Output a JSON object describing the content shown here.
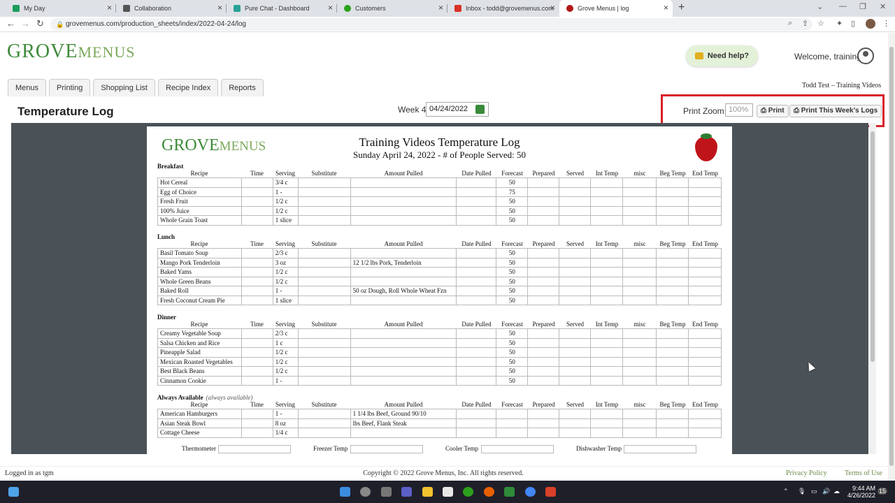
{
  "browser": {
    "tabs": [
      {
        "title": "My Day",
        "color": "#1a9c5b"
      },
      {
        "title": "Collaboration",
        "color": "#555555"
      },
      {
        "title": "Pure Chat - Dashboard",
        "color": "#2aa198"
      },
      {
        "title": "Customers",
        "color": "#2ca01c"
      },
      {
        "title": "Inbox - todd@grovemenus.com",
        "color": "#d93025"
      },
      {
        "title": "Grove Menus | log",
        "color": "#b01818"
      }
    ],
    "url": "grovemenus.com/production_sheets/index/2022-04-24/log"
  },
  "header": {
    "logo_main": "GROVE",
    "logo_sub": "MENUS",
    "help_label": "Need help?",
    "welcome": "Welcome, training",
    "tenant": "Todd Test – Training Videos"
  },
  "nav": {
    "tabs": [
      "Menus",
      "Printing",
      "Shopping List",
      "Recipe Index",
      "Reports"
    ]
  },
  "toolbar": {
    "page_title": "Temperature Log",
    "week_label": "Week 4",
    "date_value": "04/24/2022",
    "zoom_label": "Print Zoom:",
    "zoom_placeholder": "100%",
    "print_label": "Print",
    "print_week_label": "Print This Week's Logs"
  },
  "sheet": {
    "title": "Training Videos Temperature Log",
    "subtitle": "Sunday April 24, 2022 - # of People Served: 50",
    "columns": [
      "Recipe",
      "Time",
      "Serving",
      "Substitute",
      "Amount Pulled",
      "Date Pulled",
      "Forecast",
      "Prepared",
      "Served",
      "Int Temp",
      "misc",
      "Beg Temp",
      "End Temp"
    ],
    "sections": [
      {
        "name": "Breakfast",
        "note": "",
        "rows": [
          {
            "recipe": "Hot Cereal",
            "serving": "3/4 c",
            "amount": "",
            "forecast": "50"
          },
          {
            "recipe": "Egg of Choice",
            "serving": "1 -",
            "amount": "",
            "forecast": "75"
          },
          {
            "recipe": "Fresh Fruit",
            "serving": "1/2 c",
            "amount": "",
            "forecast": "50"
          },
          {
            "recipe": "100% Juice",
            "serving": "1/2 c",
            "amount": "",
            "forecast": "50"
          },
          {
            "recipe": "Whole Grain Toast",
            "serving": "1 slice",
            "amount": "",
            "forecast": "50"
          }
        ]
      },
      {
        "name": "Lunch",
        "note": "",
        "rows": [
          {
            "recipe": "Basil Tomato Soup",
            "serving": "2/3 c",
            "amount": "",
            "forecast": "50"
          },
          {
            "recipe": "Mango Pork Tenderloin",
            "serving": "3 oz",
            "amount": "12 1/2 lbs Pork, Tenderloin",
            "forecast": "50"
          },
          {
            "recipe": "Baked Yams",
            "serving": "1/2 c",
            "amount": "",
            "forecast": "50"
          },
          {
            "recipe": "Whole Green Beans",
            "serving": "1/2 c",
            "amount": "",
            "forecast": "50"
          },
          {
            "recipe": "Baked Roll",
            "serving": "1 -",
            "amount": "50 oz Dough, Roll Whole Wheat Fzn",
            "forecast": "50"
          },
          {
            "recipe": "Fresh Coconut Cream Pie",
            "serving": "1 slice",
            "amount": "",
            "forecast": "50"
          }
        ]
      },
      {
        "name": "Dinner",
        "note": "",
        "rows": [
          {
            "recipe": "Creamy Vegetable Soup",
            "serving": "2/3 c",
            "amount": "",
            "forecast": "50"
          },
          {
            "recipe": "Salsa Chicken and Rice",
            "serving": "1 c",
            "amount": "",
            "forecast": "50"
          },
          {
            "recipe": "Pineapple Salad",
            "serving": "1/2 c",
            "amount": "",
            "forecast": "50"
          },
          {
            "recipe": "Mexican Roasted Vegetables",
            "serving": "1/2 c",
            "amount": "",
            "forecast": "50"
          },
          {
            "recipe": "Best Black Beans",
            "serving": "1/2 c",
            "amount": "",
            "forecast": "50"
          },
          {
            "recipe": "Cinnamon Cookie",
            "serving": "1 -",
            "amount": "",
            "forecast": "50"
          }
        ]
      },
      {
        "name": "Always Available",
        "note": "(always available)",
        "rows": [
          {
            "recipe": "American Hamburgers",
            "serving": "1 -",
            "amount": "1 1/4 lbs Beef, Ground 90/10",
            "forecast": ""
          },
          {
            "recipe": "Asian Steak Bowl",
            "serving": "8 oz",
            "amount": "lbs Beef, Flank Steak",
            "forecast": ""
          },
          {
            "recipe": "Cottage Cheese",
            "serving": "1/4 c",
            "amount": "",
            "forecast": ""
          }
        ]
      }
    ],
    "temps": [
      "Thermometer",
      "Freezer Temp",
      "Cooler Temp",
      "Dishwasher Temp"
    ]
  },
  "footer": {
    "logged_in": "Logged in as tgm",
    "copyright": "Copyright © 2022 Grove Menus, Inc. All rights reserved.",
    "privacy": "Privacy Policy",
    "terms": "Terms of Use"
  },
  "taskbar": {
    "time": "9:44 AM",
    "date": "4/26/2022",
    "badge": "15"
  }
}
